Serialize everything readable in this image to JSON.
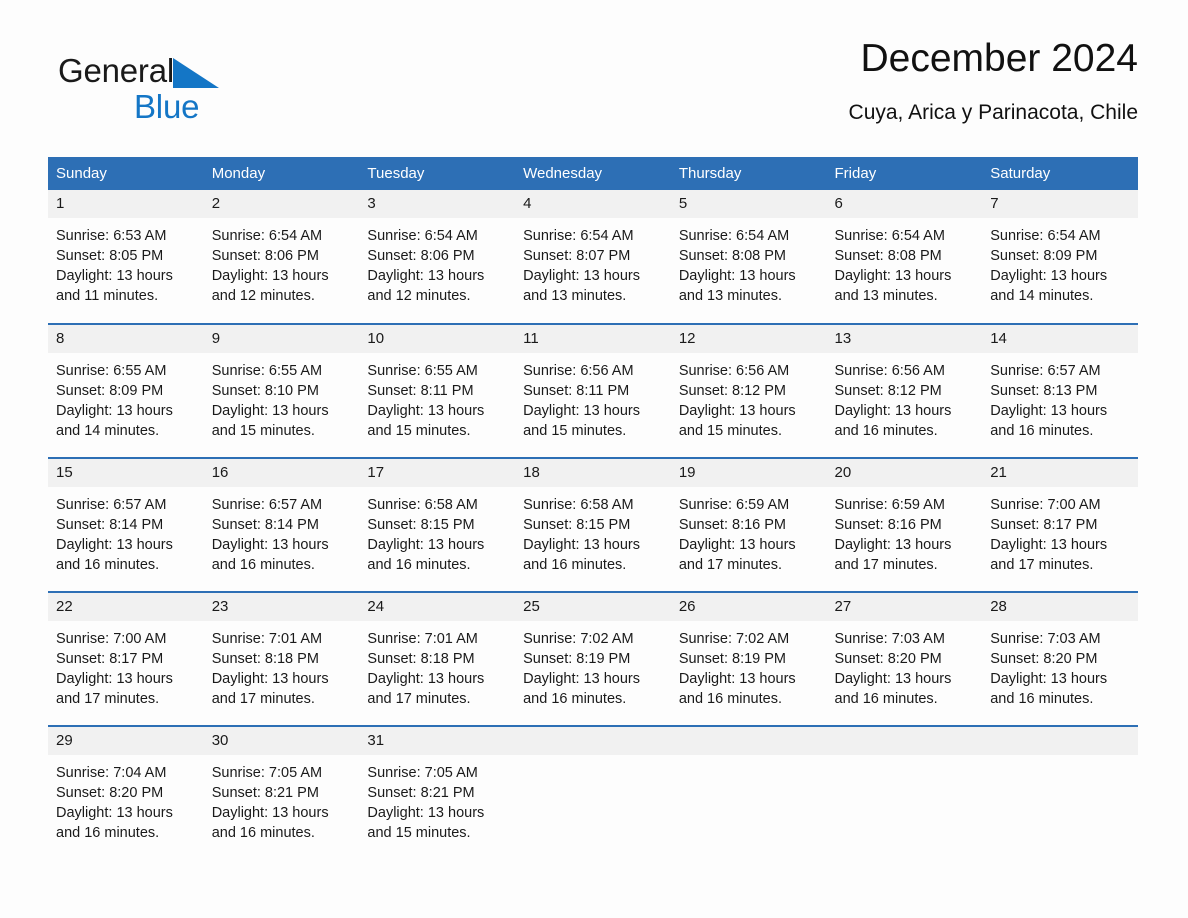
{
  "brand": {
    "name_part1": "General",
    "name_part2": "Blue",
    "triangle_color": "#1476c6"
  },
  "header": {
    "title": "December 2024",
    "location": "Cuya, Arica y Parinacota, Chile"
  },
  "theme": {
    "header_blue": "#2d6fb5",
    "daynum_bg": "#f1f1f1",
    "page_bg": "#fdfdfd",
    "text": "#1a1a1a"
  },
  "weekdays": [
    "Sunday",
    "Monday",
    "Tuesday",
    "Wednesday",
    "Thursday",
    "Friday",
    "Saturday"
  ],
  "weeks": [
    [
      {
        "day": "1",
        "sunrise": "Sunrise: 6:53 AM",
        "sunset": "Sunset: 8:05 PM",
        "daylight_line1": "Daylight: 13 hours",
        "daylight_line2": "and 11 minutes."
      },
      {
        "day": "2",
        "sunrise": "Sunrise: 6:54 AM",
        "sunset": "Sunset: 8:06 PM",
        "daylight_line1": "Daylight: 13 hours",
        "daylight_line2": "and 12 minutes."
      },
      {
        "day": "3",
        "sunrise": "Sunrise: 6:54 AM",
        "sunset": "Sunset: 8:06 PM",
        "daylight_line1": "Daylight: 13 hours",
        "daylight_line2": "and 12 minutes."
      },
      {
        "day": "4",
        "sunrise": "Sunrise: 6:54 AM",
        "sunset": "Sunset: 8:07 PM",
        "daylight_line1": "Daylight: 13 hours",
        "daylight_line2": "and 13 minutes."
      },
      {
        "day": "5",
        "sunrise": "Sunrise: 6:54 AM",
        "sunset": "Sunset: 8:08 PM",
        "daylight_line1": "Daylight: 13 hours",
        "daylight_line2": "and 13 minutes."
      },
      {
        "day": "6",
        "sunrise": "Sunrise: 6:54 AM",
        "sunset": "Sunset: 8:08 PM",
        "daylight_line1": "Daylight: 13 hours",
        "daylight_line2": "and 13 minutes."
      },
      {
        "day": "7",
        "sunrise": "Sunrise: 6:54 AM",
        "sunset": "Sunset: 8:09 PM",
        "daylight_line1": "Daylight: 13 hours",
        "daylight_line2": "and 14 minutes."
      }
    ],
    [
      {
        "day": "8",
        "sunrise": "Sunrise: 6:55 AM",
        "sunset": "Sunset: 8:09 PM",
        "daylight_line1": "Daylight: 13 hours",
        "daylight_line2": "and 14 minutes."
      },
      {
        "day": "9",
        "sunrise": "Sunrise: 6:55 AM",
        "sunset": "Sunset: 8:10 PM",
        "daylight_line1": "Daylight: 13 hours",
        "daylight_line2": "and 15 minutes."
      },
      {
        "day": "10",
        "sunrise": "Sunrise: 6:55 AM",
        "sunset": "Sunset: 8:11 PM",
        "daylight_line1": "Daylight: 13 hours",
        "daylight_line2": "and 15 minutes."
      },
      {
        "day": "11",
        "sunrise": "Sunrise: 6:56 AM",
        "sunset": "Sunset: 8:11 PM",
        "daylight_line1": "Daylight: 13 hours",
        "daylight_line2": "and 15 minutes."
      },
      {
        "day": "12",
        "sunrise": "Sunrise: 6:56 AM",
        "sunset": "Sunset: 8:12 PM",
        "daylight_line1": "Daylight: 13 hours",
        "daylight_line2": "and 15 minutes."
      },
      {
        "day": "13",
        "sunrise": "Sunrise: 6:56 AM",
        "sunset": "Sunset: 8:12 PM",
        "daylight_line1": "Daylight: 13 hours",
        "daylight_line2": "and 16 minutes."
      },
      {
        "day": "14",
        "sunrise": "Sunrise: 6:57 AM",
        "sunset": "Sunset: 8:13 PM",
        "daylight_line1": "Daylight: 13 hours",
        "daylight_line2": "and 16 minutes."
      }
    ],
    [
      {
        "day": "15",
        "sunrise": "Sunrise: 6:57 AM",
        "sunset": "Sunset: 8:14 PM",
        "daylight_line1": "Daylight: 13 hours",
        "daylight_line2": "and 16 minutes."
      },
      {
        "day": "16",
        "sunrise": "Sunrise: 6:57 AM",
        "sunset": "Sunset: 8:14 PM",
        "daylight_line1": "Daylight: 13 hours",
        "daylight_line2": "and 16 minutes."
      },
      {
        "day": "17",
        "sunrise": "Sunrise: 6:58 AM",
        "sunset": "Sunset: 8:15 PM",
        "daylight_line1": "Daylight: 13 hours",
        "daylight_line2": "and 16 minutes."
      },
      {
        "day": "18",
        "sunrise": "Sunrise: 6:58 AM",
        "sunset": "Sunset: 8:15 PM",
        "daylight_line1": "Daylight: 13 hours",
        "daylight_line2": "and 16 minutes."
      },
      {
        "day": "19",
        "sunrise": "Sunrise: 6:59 AM",
        "sunset": "Sunset: 8:16 PM",
        "daylight_line1": "Daylight: 13 hours",
        "daylight_line2": "and 17 minutes."
      },
      {
        "day": "20",
        "sunrise": "Sunrise: 6:59 AM",
        "sunset": "Sunset: 8:16 PM",
        "daylight_line1": "Daylight: 13 hours",
        "daylight_line2": "and 17 minutes."
      },
      {
        "day": "21",
        "sunrise": "Sunrise: 7:00 AM",
        "sunset": "Sunset: 8:17 PM",
        "daylight_line1": "Daylight: 13 hours",
        "daylight_line2": "and 17 minutes."
      }
    ],
    [
      {
        "day": "22",
        "sunrise": "Sunrise: 7:00 AM",
        "sunset": "Sunset: 8:17 PM",
        "daylight_line1": "Daylight: 13 hours",
        "daylight_line2": "and 17 minutes."
      },
      {
        "day": "23",
        "sunrise": "Sunrise: 7:01 AM",
        "sunset": "Sunset: 8:18 PM",
        "daylight_line1": "Daylight: 13 hours",
        "daylight_line2": "and 17 minutes."
      },
      {
        "day": "24",
        "sunrise": "Sunrise: 7:01 AM",
        "sunset": "Sunset: 8:18 PM",
        "daylight_line1": "Daylight: 13 hours",
        "daylight_line2": "and 17 minutes."
      },
      {
        "day": "25",
        "sunrise": "Sunrise: 7:02 AM",
        "sunset": "Sunset: 8:19 PM",
        "daylight_line1": "Daylight: 13 hours",
        "daylight_line2": "and 16 minutes."
      },
      {
        "day": "26",
        "sunrise": "Sunrise: 7:02 AM",
        "sunset": "Sunset: 8:19 PM",
        "daylight_line1": "Daylight: 13 hours",
        "daylight_line2": "and 16 minutes."
      },
      {
        "day": "27",
        "sunrise": "Sunrise: 7:03 AM",
        "sunset": "Sunset: 8:20 PM",
        "daylight_line1": "Daylight: 13 hours",
        "daylight_line2": "and 16 minutes."
      },
      {
        "day": "28",
        "sunrise": "Sunrise: 7:03 AM",
        "sunset": "Sunset: 8:20 PM",
        "daylight_line1": "Daylight: 13 hours",
        "daylight_line2": "and 16 minutes."
      }
    ],
    [
      {
        "day": "29",
        "sunrise": "Sunrise: 7:04 AM",
        "sunset": "Sunset: 8:20 PM",
        "daylight_line1": "Daylight: 13 hours",
        "daylight_line2": "and 16 minutes."
      },
      {
        "day": "30",
        "sunrise": "Sunrise: 7:05 AM",
        "sunset": "Sunset: 8:21 PM",
        "daylight_line1": "Daylight: 13 hours",
        "daylight_line2": "and 16 minutes."
      },
      {
        "day": "31",
        "sunrise": "Sunrise: 7:05 AM",
        "sunset": "Sunset: 8:21 PM",
        "daylight_line1": "Daylight: 13 hours",
        "daylight_line2": "and 15 minutes."
      },
      {
        "day": "",
        "sunrise": "",
        "sunset": "",
        "daylight_line1": "",
        "daylight_line2": "",
        "blank": true
      },
      {
        "day": "",
        "sunrise": "",
        "sunset": "",
        "daylight_line1": "",
        "daylight_line2": "",
        "blank": true
      },
      {
        "day": "",
        "sunrise": "",
        "sunset": "",
        "daylight_line1": "",
        "daylight_line2": "",
        "blank": true
      },
      {
        "day": "",
        "sunrise": "",
        "sunset": "",
        "daylight_line1": "",
        "daylight_line2": "",
        "blank": true
      }
    ]
  ]
}
